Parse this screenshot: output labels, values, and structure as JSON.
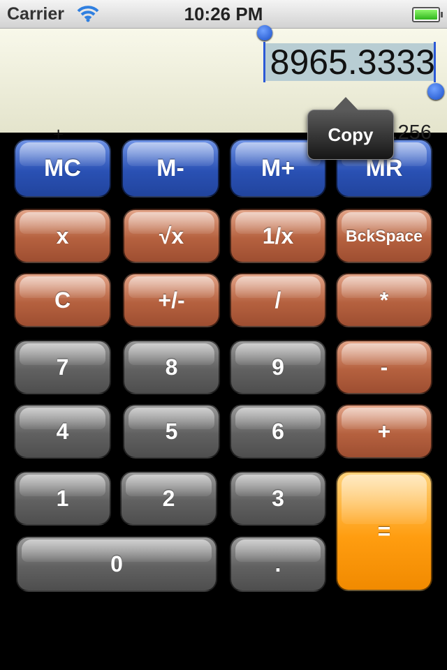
{
  "status_bar": {
    "carrier": "Carrier",
    "time": "10:26 PM",
    "battery_level": 1.0
  },
  "display": {
    "main_value": "8965.3333",
    "operator": "+",
    "previous_value": "698.256"
  },
  "copy_popup": {
    "label": "Copy"
  },
  "keys": {
    "mc": "MC",
    "m_minus": "M-",
    "m_plus": "M+",
    "mr": "MR",
    "x": "x",
    "sqrt": "√x",
    "reciprocal": "1/x",
    "backspace": "BckSpace",
    "clear": "C",
    "sign": "+/-",
    "divide": "/",
    "multiply": "*",
    "seven": "7",
    "eight": "8",
    "nine": "9",
    "minus": "-",
    "four": "4",
    "five": "5",
    "six": "6",
    "plus": "+",
    "one": "1",
    "two": "2",
    "three": "3",
    "equals": "=",
    "zero": "0",
    "decimal": "."
  },
  "colors": {
    "memory_keys": "#2a51b4",
    "function_keys": "#b5613f",
    "digit_keys": "#616161",
    "equals_key": "#ff9d10",
    "selection": "#2b59d6"
  }
}
